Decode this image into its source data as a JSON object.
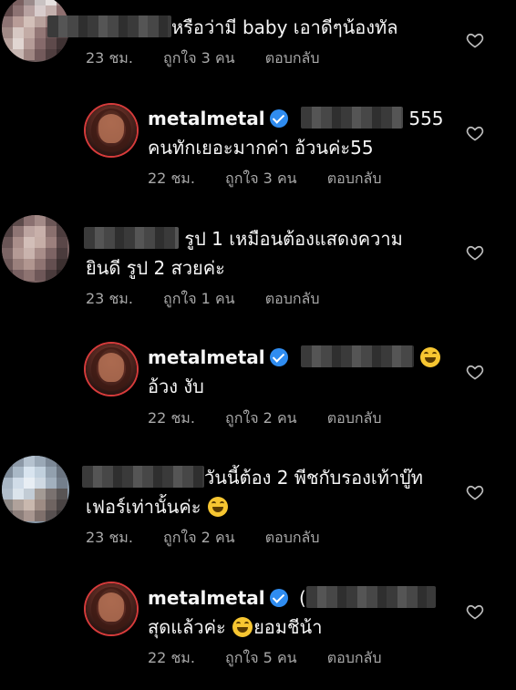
{
  "comments": [
    {
      "text": "หรือว่ามี baby เอาดีๆน้องทัล",
      "time": "23 ชม.",
      "likes": "ถูกใจ 3 คน",
      "reply": "ตอบกลับ"
    },
    {
      "username": "metalmetal",
      "mention_suffix": "555",
      "line2": "คนทักเยอะมากค่า อ้วนค่ะ55",
      "time": "22 ชม.",
      "likes": "ถูกใจ 3 คน",
      "reply": "ตอบกลับ"
    },
    {
      "line1": "รูป 1 เหมือนต้องแสดงความ",
      "line2": "ยินดี  รูป 2 สวยค่ะ",
      "time": "23 ชม.",
      "likes": "ถูกใจ 1 คน",
      "reply": "ตอบกลับ"
    },
    {
      "username": "metalmetal",
      "line2": "อ้วง งับ",
      "time": "22 ชม.",
      "likes": "ถูกใจ 2 คน",
      "reply": "ตอบกลับ"
    },
    {
      "line1": "วันนี้ต้อง 2 พีชกับรองเท้าบู๊ท",
      "line2": "เฟอร์เท่านั้นค่ะ",
      "time": "23 ชม.",
      "likes": "ถูกใจ 2 คน",
      "reply": "ตอบกลับ"
    },
    {
      "username": "metalmetal",
      "mention_prefix": "(",
      "line2a": "สุดแล้วค่ะ",
      "line2b": "ยอมชีน้า",
      "time": "22 ชม.",
      "likes": "ถูกใจ 5 คน",
      "reply": "ตอบกลับ"
    }
  ],
  "icons": {
    "like": "heart-outline-icon",
    "verified": "verified-badge-icon",
    "emoji": "grinning-sweat-emoji"
  },
  "colors": {
    "background": "#000000",
    "text": "#f5f5f5",
    "muted": "#a8a8a8",
    "verified": "#2f8cf0"
  }
}
